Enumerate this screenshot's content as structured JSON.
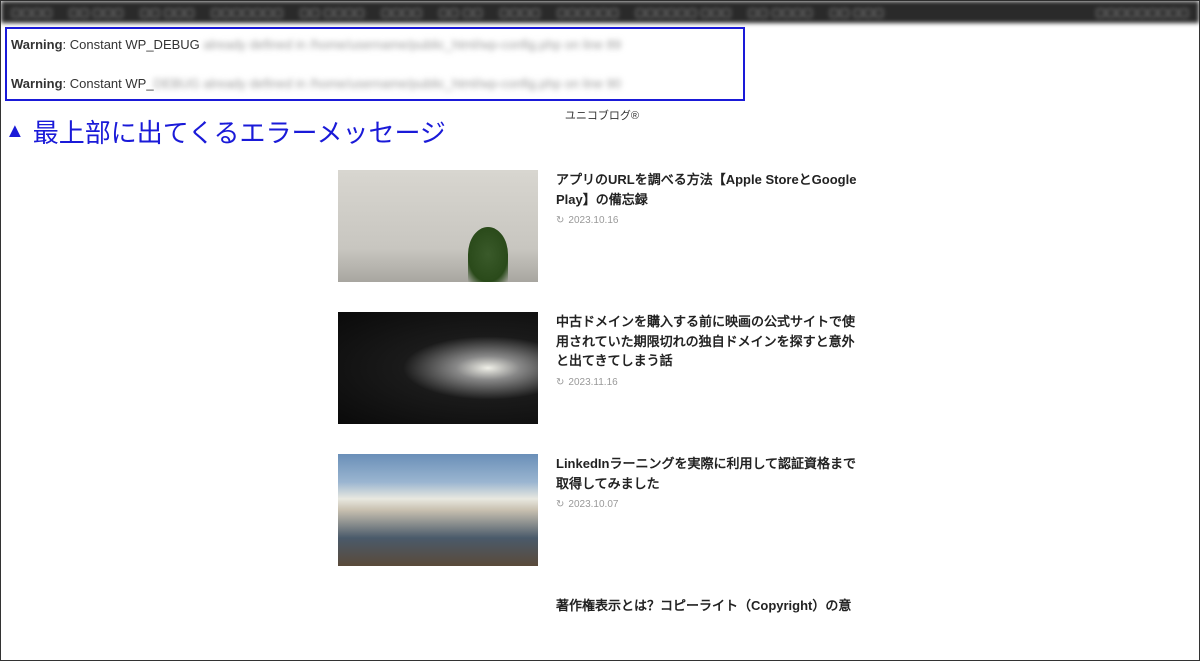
{
  "admin_bar": {
    "items": [
      "▢▢▢▢",
      "▢▢ ▢▢▢",
      "▢▢ ▢▢▢",
      "▢▢▢▢▢▢▢",
      "▢▢ ▢▢▢▢",
      "▢▢▢▢",
      "▢▢ ▢▢",
      "▢▢▢▢",
      "▢▢▢▢▢▢",
      "▢▢▢▢▢▢ ▢▢▢",
      "▢▢ ▢▢▢▢",
      "▢▢ ▢▢▢"
    ],
    "right": "▢▢▢▢▢▢▢▢▢"
  },
  "errors": [
    {
      "label": "Warning",
      "text": ": Constant WP_DEBUG ",
      "blurred": "already defined in /home/username/public_html/wp-config.php on line 89"
    },
    {
      "label": "Warning",
      "text": ": Constant WP_",
      "blurred": "DEBUG already defined in /home/username/public_html/wp-config.php on line 90"
    }
  ],
  "annotation": {
    "triangle": "▲",
    "text": "最上部に出てくるエラーメッセージ"
  },
  "site_title": "ユニコブログ®",
  "articles": [
    {
      "title": "アプリのURLを調べる方法【Apple StoreとGoogle Play】の備忘録",
      "date": "2023.10.16"
    },
    {
      "title": "中古ドメインを購入する前に映画の公式サイトで使用されていた期限切れの独自ドメインを探すと意外と出てきてしまう話",
      "date": "2023.11.16"
    },
    {
      "title": "LinkedInラーニングを実際に利用して認証資格まで取得してみました",
      "date": "2023.10.07"
    }
  ],
  "article_partial": {
    "title": "著作権表示とは？コピーライト（Copyright）の意"
  }
}
